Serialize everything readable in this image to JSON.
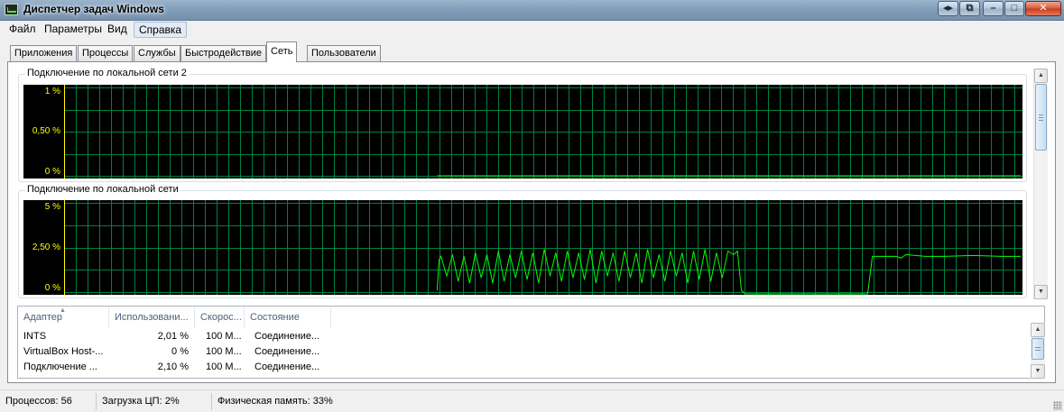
{
  "window": {
    "title": "Диспетчер задач Windows",
    "buttons": {
      "switch": "◂▸",
      "restore": "⧉",
      "minimize": "–",
      "maximize": "□",
      "close": "✕"
    }
  },
  "menu": [
    "Файл",
    "Параметры",
    "Вид",
    "Справка"
  ],
  "tabs": [
    "Приложения",
    "Процессы",
    "Службы",
    "Быстродействие",
    "Сеть",
    "Пользователи"
  ],
  "active_tab": "Сеть",
  "colors": {
    "graph_bg": "#000000",
    "grid": "#008040",
    "line": "#00ff00",
    "axis_label": "#ffff00"
  },
  "graphs": [
    {
      "caption": "Подключение по локальной сети 2",
      "y_labels": [
        "1 %",
        "0,50 %",
        "0 %"
      ],
      "chart_data": {
        "type": "line",
        "ylim": [
          0,
          1
        ],
        "unit": "%",
        "series": [
          {
            "x": [
              0.39,
              1.0
            ],
            "y": [
              0,
              0
            ]
          }
        ]
      }
    },
    {
      "caption": "Подключение по локальной сети",
      "y_labels": [
        "5 %",
        "2,50 %",
        "0 %"
      ],
      "chart_data": {
        "type": "line",
        "ylim": [
          0,
          5
        ],
        "unit": "%",
        "series": [
          {
            "x": [
              0.39,
              0.392,
              0.394,
              0.4,
              0.406,
              0.412,
              0.418,
              0.424,
              0.43,
              0.436,
              0.442,
              0.448,
              0.454,
              0.46,
              0.466,
              0.472,
              0.478,
              0.484,
              0.49,
              0.496,
              0.502,
              0.508,
              0.514,
              0.52,
              0.526,
              0.532,
              0.538,
              0.544,
              0.55,
              0.556,
              0.562,
              0.568,
              0.574,
              0.58,
              0.586,
              0.592,
              0.598,
              0.604,
              0.61,
              0.616,
              0.622,
              0.628,
              0.634,
              0.64,
              0.646,
              0.652,
              0.658,
              0.664,
              0.67,
              0.676,
              0.682,
              0.688,
              0.694,
              0.7,
              0.704,
              0.708,
              0.712,
              0.78,
              0.786,
              0.79,
              0.8,
              0.84,
              0.845,
              0.85,
              0.86,
              0.87,
              0.875,
              0.88,
              0.9,
              0.92,
              0.95,
              0.98,
              1.0
            ],
            "y": [
              0.1,
              1.8,
              2.0,
              0.9,
              2.1,
              0.6,
              2.0,
              0.5,
              2.2,
              0.8,
              2.1,
              0.5,
              2.3,
              0.6,
              2.1,
              0.8,
              2.3,
              0.7,
              2.2,
              0.5,
              2.4,
              0.9,
              2.2,
              0.6,
              2.3,
              0.8,
              2.2,
              0.7,
              2.4,
              0.5,
              2.3,
              0.9,
              2.2,
              0.6,
              2.3,
              0.8,
              2.2,
              0.5,
              2.4,
              0.8,
              2.1,
              0.6,
              2.3,
              0.9,
              2.2,
              0.5,
              2.3,
              0.7,
              2.4,
              0.6,
              2.2,
              0.8,
              2.3,
              2.1,
              2.3,
              0.1,
              -0.1,
              -0.1,
              -0.1,
              -0.1,
              -0.1,
              -0.1,
              2.0,
              2.0,
              2.0,
              2.0,
              1.9,
              2.1,
              2.0,
              2.0,
              2.05,
              2.0,
              2.0
            ]
          }
        ]
      }
    }
  ],
  "list": {
    "columns": [
      "Адаптер",
      "Использовани...",
      "Скорос...",
      "Состояние"
    ],
    "rows": [
      [
        "INTS",
        "2,01 %",
        "100 М...",
        "Соединение..."
      ],
      [
        "VirtualBox Host-...",
        "0 %",
        "100 М...",
        "Соединение..."
      ],
      [
        "Подключение ...",
        "2,10 %",
        "100 М...",
        "Соединение..."
      ]
    ]
  },
  "status": {
    "processes": "Процессов: 56",
    "cpu": "Загрузка ЦП: 2%",
    "memory": "Физическая память: 33%"
  }
}
